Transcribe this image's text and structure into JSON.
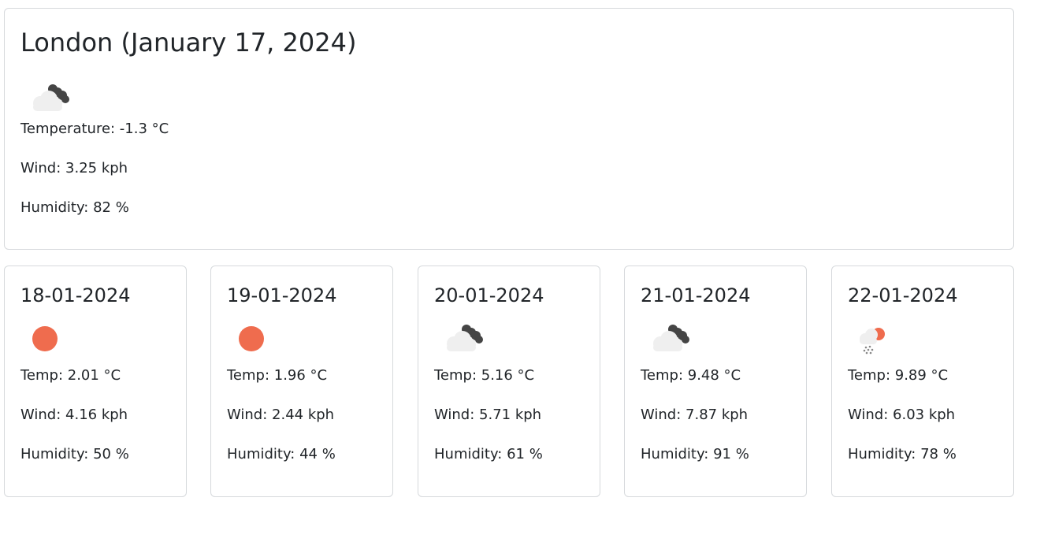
{
  "current": {
    "title": "London (January 17, 2024)",
    "icon": "cloudy-icon",
    "temperature": "Temperature: -1.3 °C",
    "wind": "Wind: 3.25 kph",
    "humidity": "Humidity: 82 %"
  },
  "forecast": [
    {
      "date": "18-01-2024",
      "icon": "sun-icon",
      "temp": "Temp: 2.01 °C",
      "wind": "Wind: 4.16 kph",
      "humidity": "Humidity: 50 %"
    },
    {
      "date": "19-01-2024",
      "icon": "sun-icon",
      "temp": "Temp: 1.96 °C",
      "wind": "Wind: 2.44 kph",
      "humidity": "Humidity: 44 %"
    },
    {
      "date": "20-01-2024",
      "icon": "cloudy-icon",
      "temp": "Temp: 5.16 °C",
      "wind": "Wind: 5.71 kph",
      "humidity": "Humidity: 61 %"
    },
    {
      "date": "21-01-2024",
      "icon": "cloudy-icon",
      "temp": "Temp: 9.48 °C",
      "wind": "Wind: 7.87 kph",
      "humidity": "Humidity: 91 %"
    },
    {
      "date": "22-01-2024",
      "icon": "rain-sun-icon",
      "temp": "Temp: 9.89 °C",
      "wind": "Wind: 6.03 kph",
      "humidity": "Humidity: 78 %"
    }
  ],
  "colors": {
    "sun": "#ef6c4e",
    "dark_cloud": "#454545",
    "light_cloud": "#efefef",
    "rain": "#888888",
    "border": "#d6d9dc"
  }
}
